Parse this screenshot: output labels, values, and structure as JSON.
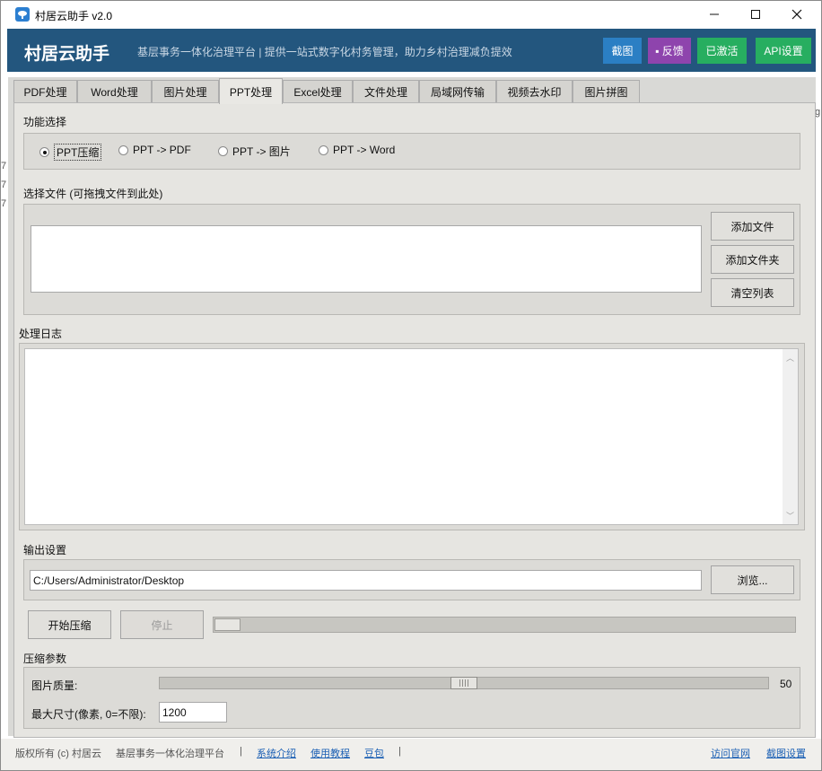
{
  "window": {
    "title": "村居云助手 v2.0",
    "app_icon": "cloud-logo-icon"
  },
  "banner": {
    "title": "村居云助手",
    "subtitle": "基层事务一体化治理平台 | 提供一站式数字化村务管理，助力乡村治理减负提效",
    "buttons": {
      "screenshot": "截图",
      "feedback": "▪ 反馈",
      "activated": "已激活",
      "api": "API设置"
    },
    "colors": {
      "bg": "#23567e",
      "screenshot": "#2b7fc4",
      "feedback": "#8e44ad",
      "activated": "#27ae60",
      "api": "#27ae60"
    }
  },
  "tabs": [
    "PDF处理",
    "Word处理",
    "图片处理",
    "PPT处理",
    "Excel处理",
    "文件处理",
    "局域网传输",
    "视频去水印",
    "图片拼图"
  ],
  "active_tab": "PPT处理",
  "function_select": {
    "label": "功能选择",
    "options": [
      "PPT压缩",
      "PPT -> PDF",
      "PPT -> 图片",
      "PPT -> Word"
    ],
    "selected": "PPT压缩"
  },
  "file_select": {
    "label": "选择文件 (可拖拽文件到此处)",
    "add_file": "添加文件",
    "add_folder": "添加文件夹",
    "clear_list": "清空列表"
  },
  "log": {
    "label": "处理日志"
  },
  "output": {
    "label": "输出设置",
    "path": "C:/Users/Administrator/Desktop",
    "browse": "浏览..."
  },
  "actions": {
    "start": "开始压缩",
    "stop": "停止",
    "progress": 0
  },
  "compress_params": {
    "label": "压缩参数",
    "quality_label": "图片质量:",
    "quality_value": "50",
    "quality_range": [
      0,
      100
    ],
    "max_size_label": "最大尺寸(像素, 0=不限):",
    "max_size_value": "1200"
  },
  "footer": {
    "copyright": "版权所有 (c) 村居云",
    "platform": "基层事务一体化治理平台",
    "sep1": "|",
    "link_intro": "系统介绍",
    "link_tutorial": "使用教程",
    "link_doubao": "豆包",
    "sep2": "|",
    "link_site": "访问官网",
    "link_shot_settings": "截图设置"
  },
  "edge_glyphs": [
    "g",
    "7",
    "7",
    "7"
  ]
}
